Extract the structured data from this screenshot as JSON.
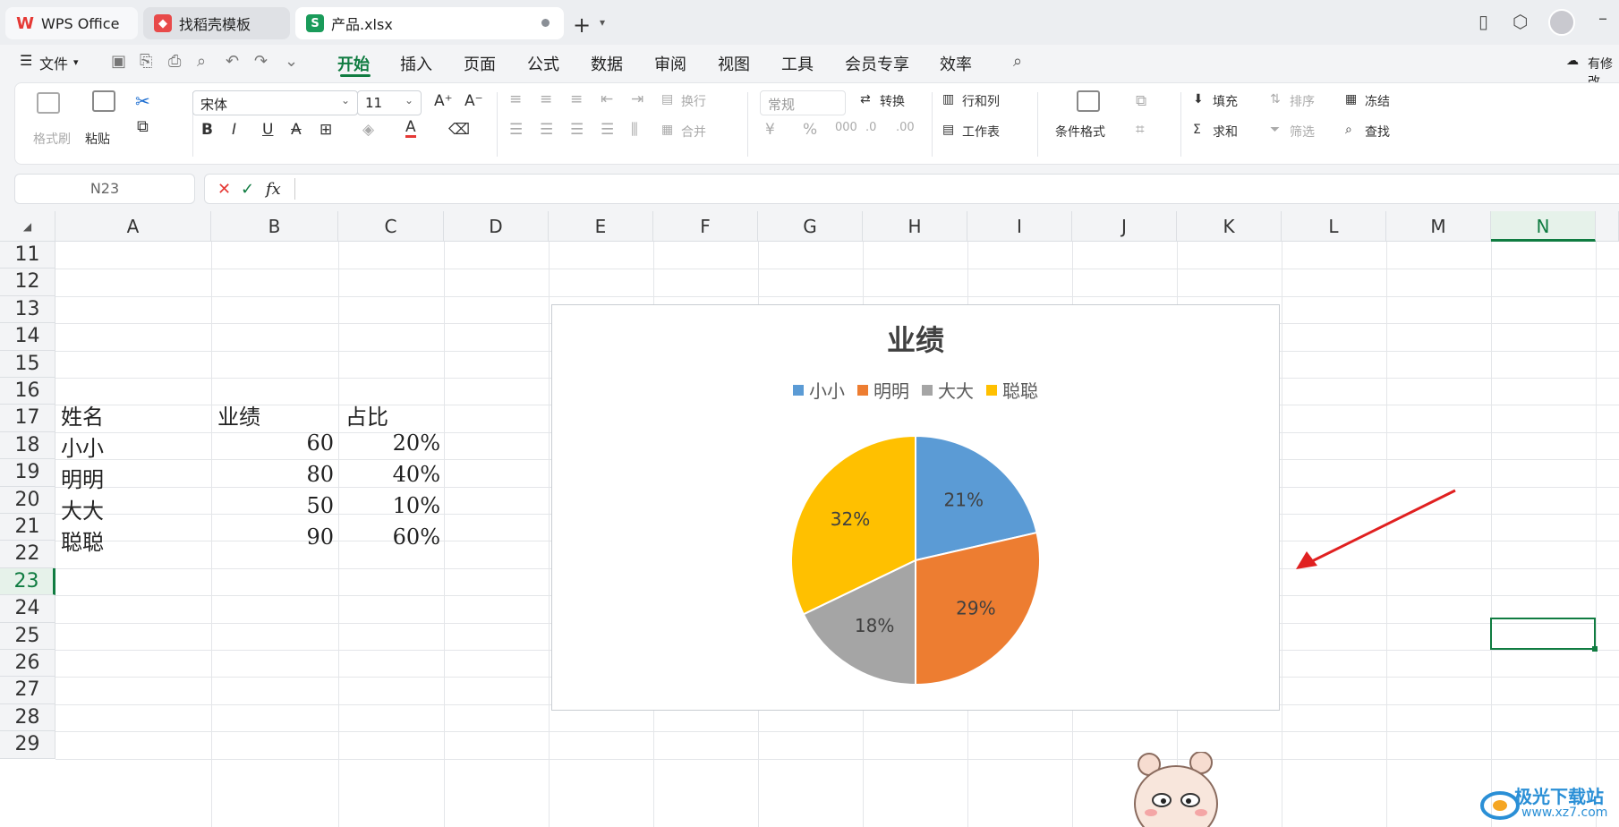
{
  "titlebar": {
    "tabs": [
      {
        "label": "WPS Office"
      },
      {
        "label": "找稻壳模板"
      },
      {
        "label": "产品.xlsx"
      }
    ]
  },
  "menubar": {
    "file_label": "文件",
    "tabs": [
      "开始",
      "插入",
      "页面",
      "公式",
      "数据",
      "审阅",
      "视图",
      "工具",
      "会员专享",
      "效率"
    ],
    "active_tab": "开始",
    "right_label": "有修改"
  },
  "ribbon": {
    "format_painter": "格式刷",
    "paste": "粘贴",
    "font_name": "宋体",
    "font_size": "11",
    "wrap_text": "换行",
    "merge": "合并",
    "number_format": "常规",
    "convert": "转换",
    "rows_cols": "行和列",
    "worksheet": "工作表",
    "conditional_format": "条件格式",
    "fill": "填充",
    "sort": "排序",
    "freeze": "冻结",
    "sum": "求和",
    "filter": "筛选",
    "find": "查找"
  },
  "formula_bar": {
    "name_box": "N23",
    "fx_label": "fx",
    "value": ""
  },
  "sheet": {
    "columns": [
      "A",
      "B",
      "C",
      "D",
      "E",
      "F",
      "G",
      "H",
      "I",
      "J",
      "K",
      "L",
      "M",
      "N"
    ],
    "rows": [
      "11",
      "12",
      "13",
      "14",
      "15",
      "16",
      "17",
      "18",
      "19",
      "20",
      "21",
      "22",
      "23",
      "24",
      "25",
      "26",
      "27",
      "28",
      "29"
    ],
    "selected_cell": "N23",
    "table": {
      "headers": [
        "姓名",
        "业绩",
        "占比"
      ],
      "rows": [
        [
          "小小",
          "60",
          "20%"
        ],
        [
          "明明",
          "80",
          "40%"
        ],
        [
          "大大",
          "50",
          "10%"
        ],
        [
          "聪聪",
          "90",
          "60%"
        ]
      ]
    }
  },
  "chart_data": {
    "type": "pie",
    "title": "业绩",
    "categories": [
      "小小",
      "明明",
      "大大",
      "聪聪"
    ],
    "values": [
      60,
      80,
      50,
      90
    ],
    "labels": [
      "21%",
      "29%",
      "18%",
      "32%"
    ],
    "colors": [
      "#5b9bd5",
      "#ed7d31",
      "#a5a5a5",
      "#ffc000"
    ],
    "legend_position": "top"
  },
  "watermark": {
    "text": "极光下载站",
    "url": "www.xz7.com"
  },
  "accent_color": "#107c41"
}
